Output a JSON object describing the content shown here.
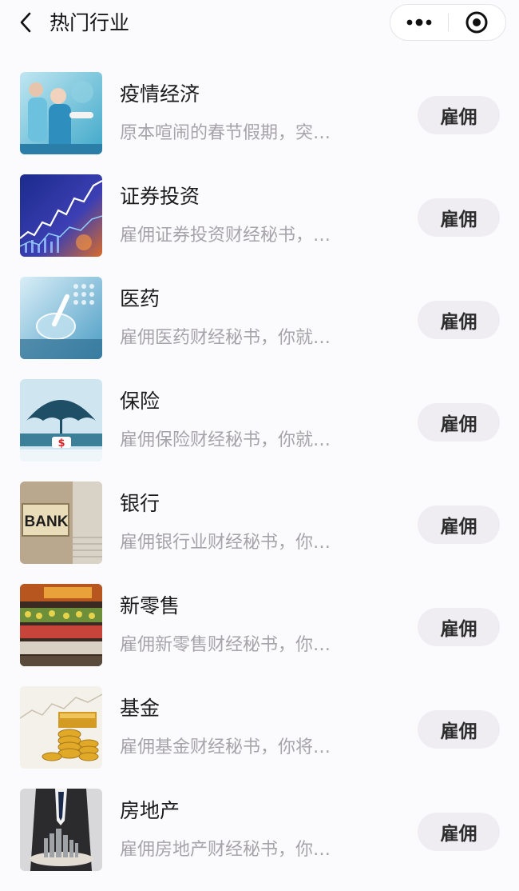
{
  "header": {
    "title": "热门行业",
    "back_icon": "chevron-left-icon",
    "more_icon": "more-dots-icon",
    "close_icon": "target-close-icon"
  },
  "items": [
    {
      "title": "疫情经济",
      "desc": "原本喧闹的春节假期，突…",
      "button": "雇佣",
      "image": "medical-staff-photo"
    },
    {
      "title": "证券投资",
      "desc": "雇佣证券投资财经秘书，…",
      "button": "雇佣",
      "image": "stock-chart-photo"
    },
    {
      "title": "医药",
      "desc": "雇佣医药财经秘书，你就…",
      "button": "雇佣",
      "image": "lab-pipette-photo"
    },
    {
      "title": "保险",
      "desc": "雇佣保险财经秘书，你就…",
      "button": "雇佣",
      "image": "umbrella-dollar-photo"
    },
    {
      "title": "银行",
      "desc": "雇佣银行业财经秘书，你…",
      "button": "雇佣",
      "image": "bank-sign-photo",
      "image_text": "BANK"
    },
    {
      "title": "新零售",
      "desc": "雇佣新零售财经秘书，你…",
      "button": "雇佣",
      "image": "supermarket-photo"
    },
    {
      "title": "基金",
      "desc": "雇佣基金财经秘书，你将…",
      "button": "雇佣",
      "image": "gold-coins-photo"
    },
    {
      "title": "房地产",
      "desc": "雇佣房地产财经秘书，你…",
      "button": "雇佣",
      "image": "businessman-city-photo"
    }
  ]
}
